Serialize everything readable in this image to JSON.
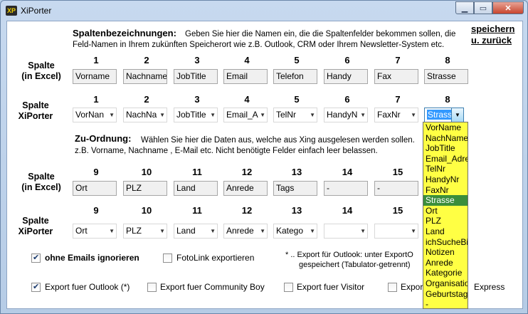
{
  "window": {
    "title": "XiPorter",
    "icon_text": "XP"
  },
  "header": {
    "section_title": "Spaltenbezeichnungen:",
    "description_line1": "Geben Sie hier die Namen ein, die die Spaltenfelder bekommen sollen, die",
    "description_line2": "Feld-Namen in Ihrem zukünften Speicherort wie z.B. Outlook, CRM oder Ihrem Newsletter-System etc."
  },
  "links": {
    "save": "speichern",
    "back": "u.  zurück"
  },
  "labels": {
    "excel": "Spalte\n(in Excel)",
    "xiporter": "Spalte\nXiPorter"
  },
  "row1": {
    "numbers": [
      "1",
      "2",
      "3",
      "4",
      "5",
      "6",
      "7",
      "8"
    ],
    "excel_values": [
      "Vorname",
      "Nachname",
      "JobTitle",
      "Email",
      "Telefon",
      "Handy",
      "Fax",
      "Strasse"
    ],
    "xiporter_values": [
      "VorNan",
      "NachNa",
      "JobTitle",
      "Email_A",
      "TelNr",
      "HandyN",
      "FaxNr",
      "Strasse"
    ]
  },
  "zuordnung": {
    "title": "Zu-Ordnung:",
    "line1": "Wählen Sie hier die Daten aus, welche aus Xing ausgelesen werden sollen.",
    "line2": "z.B. Vorname, Nachname , E-Mail etc. Nicht benötigte Felder einfach leer belassen."
  },
  "row2": {
    "numbers": [
      "9",
      "10",
      "11",
      "12",
      "13",
      "14",
      "15"
    ],
    "excel_values": [
      "Ort",
      "PLZ",
      "Land",
      "Anrede",
      "Tags",
      "-",
      "-"
    ],
    "xiporter_values": [
      "Ort",
      "PLZ",
      "Land",
      "Anrede",
      "Katego",
      "",
      ""
    ]
  },
  "dropdown": {
    "items": [
      "VorName",
      "NachName",
      "JobTitle",
      "Email_Adresse",
      "TelNr",
      "HandyNr",
      "FaxNr",
      "Strasse",
      "Ort",
      "PLZ",
      "Land",
      "ichSucheBiete",
      "Notizen",
      "Anrede",
      "Kategorie",
      "Organisation",
      "Geburtstag",
      "-"
    ],
    "selected": "Strasse",
    "background": "#ffff44",
    "highlight": "#3b8e3b"
  },
  "options": {
    "ignore_no_email": {
      "label": "ohne Emails ignorieren",
      "checked": true
    },
    "fotolink": {
      "label": "FotoLink exportieren",
      "checked": false
    },
    "note_line1": "* .. Export für Outlook: unter ExportO",
    "note_line2": "gespeichert (Tabulator-getrennt)",
    "export_outlook": {
      "label": "Export fuer Outlook (*)",
      "checked": true
    },
    "export_community": {
      "label": "Export fuer Community Boy",
      "checked": false
    },
    "export_visitor": {
      "label": "Export fuer Visitor",
      "checked": false
    },
    "export_express_prefix": {
      "label": "Export",
      "checked": false
    },
    "export_express_suffix": "Express"
  }
}
